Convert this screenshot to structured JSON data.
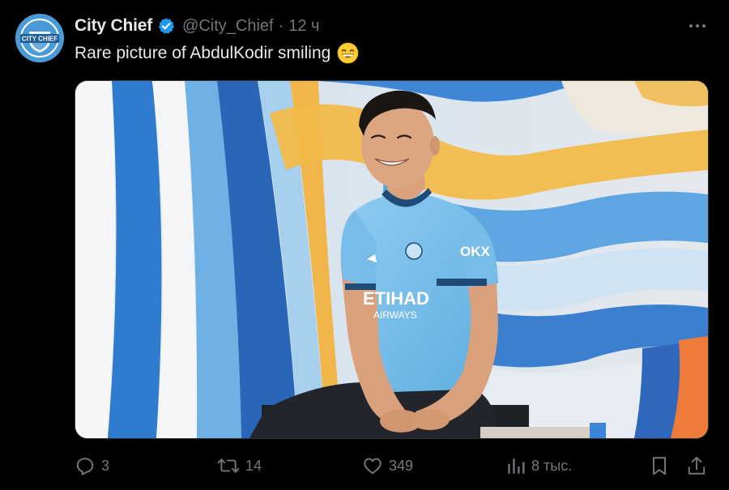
{
  "tweet": {
    "author": {
      "name": "City Chief",
      "handle": "@City_Chief",
      "avatar_text": "CITY CHIEF",
      "verified": true
    },
    "separator": "·",
    "time": "12 ч",
    "text": "Rare picture of AbdulKodir smiling",
    "emoji": "grinning-face-with-smiling-eyes-emoji",
    "media": {
      "shirt_sponsor": "ETIHAD",
      "shirt_sponsor_line2": "AIRWAYS",
      "sleeve_sponsor": "OKX"
    }
  },
  "actions": {
    "reply_count": "3",
    "retweet_count": "14",
    "like_count": "349",
    "views_count": "8 тыс."
  },
  "icons": {
    "verified": "verified-badge-icon",
    "more": "more-icon",
    "reply": "reply-icon",
    "retweet": "retweet-icon",
    "like": "heart-icon",
    "views": "views-icon",
    "bookmark": "bookmark-icon",
    "share": "share-icon"
  },
  "colors": {
    "background": "#000000",
    "text_primary": "#e7e9ea",
    "text_secondary": "#71767b",
    "verified_blue": "#1d9bf0",
    "city_blue": "#6cabdd"
  }
}
